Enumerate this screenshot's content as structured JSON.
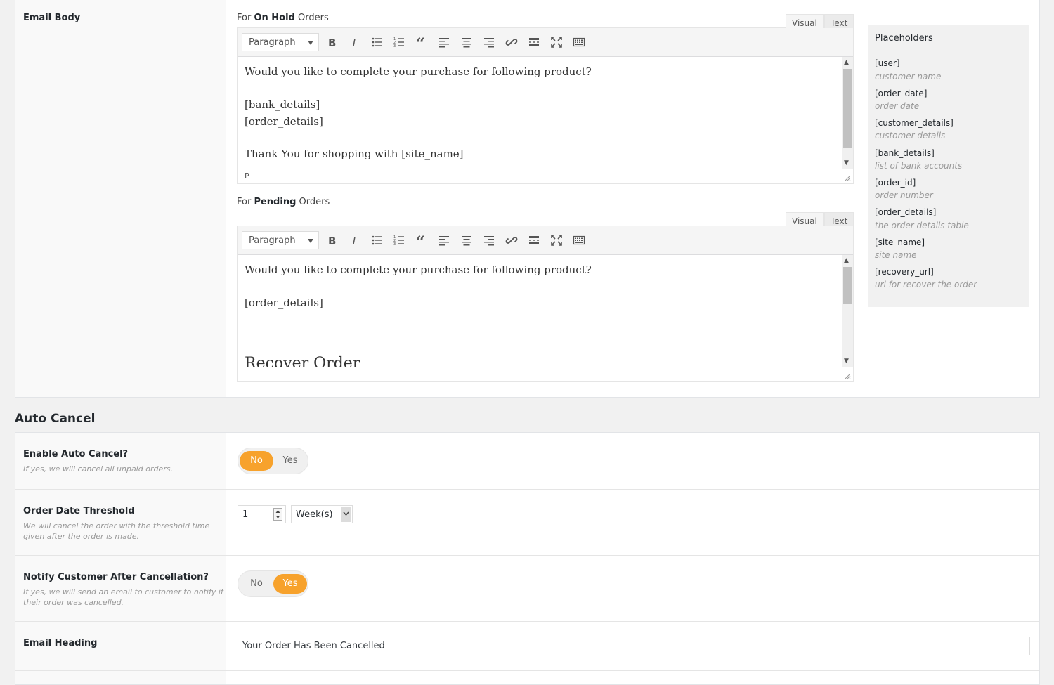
{
  "email_body": {
    "label": "Email Body",
    "on_hold": {
      "label_prefix": "For",
      "label_bold": "On Hold",
      "label_suffix": "Orders",
      "tab_visual": "Visual",
      "tab_text": "Text",
      "format": "Paragraph",
      "lines": [
        "Would you like to complete your purchase for following product?",
        "",
        "[bank_details]",
        "[order_details]",
        "",
        "Thank You for shopping with [site_name]"
      ],
      "path": "P"
    },
    "pending": {
      "label_prefix": "For",
      "label_bold": "Pending",
      "label_suffix": "Orders",
      "tab_visual": "Visual",
      "tab_text": "Text",
      "format": "Paragraph",
      "lines": [
        "Would you like to complete your purchase for following product?",
        "",
        "[order_details]"
      ],
      "heading": "Recover Order"
    }
  },
  "toolbar_icons": [
    "bold-icon",
    "italic-icon",
    "bullet-list-icon",
    "numbered-list-icon",
    "blockquote-icon",
    "align-left-icon",
    "align-center-icon",
    "align-right-icon",
    "link-icon",
    "read-more-icon",
    "fullscreen-icon",
    "toolbar-toggle-icon"
  ],
  "placeholders": {
    "title": "Placeholders",
    "items": [
      {
        "code": "[user]",
        "desc": "customer name"
      },
      {
        "code": "[order_date]",
        "desc": "order date"
      },
      {
        "code": "[customer_details]",
        "desc": "customer details"
      },
      {
        "code": "[bank_details]",
        "desc": "list of bank accounts"
      },
      {
        "code": "[order_id]",
        "desc": "order number"
      },
      {
        "code": "[order_details]",
        "desc": "the order details table"
      },
      {
        "code": "[site_name]",
        "desc": "site name"
      },
      {
        "code": "[recovery_url]",
        "desc": "url for recover the order"
      }
    ]
  },
  "auto_cancel": {
    "title": "Auto Cancel",
    "enable": {
      "label": "Enable Auto Cancel?",
      "desc": "If yes, we will cancel all unpaid orders.",
      "no": "No",
      "yes": "Yes",
      "selected": "No"
    },
    "threshold": {
      "label": "Order Date Threshold",
      "desc": "We will cancel the order with the threshold time given after the order is made.",
      "value": "1",
      "unit": "Week(s)"
    },
    "notify": {
      "label": "Notify Customer After Cancellation?",
      "desc": "If yes, we will send an email to customer to notify if their order was cancelled.",
      "no": "No",
      "yes": "Yes",
      "selected": "Yes"
    },
    "email_heading": {
      "label": "Email Heading",
      "value": "Your Order Has Been Cancelled"
    }
  },
  "colors": {
    "accent": "#f7a22c"
  }
}
